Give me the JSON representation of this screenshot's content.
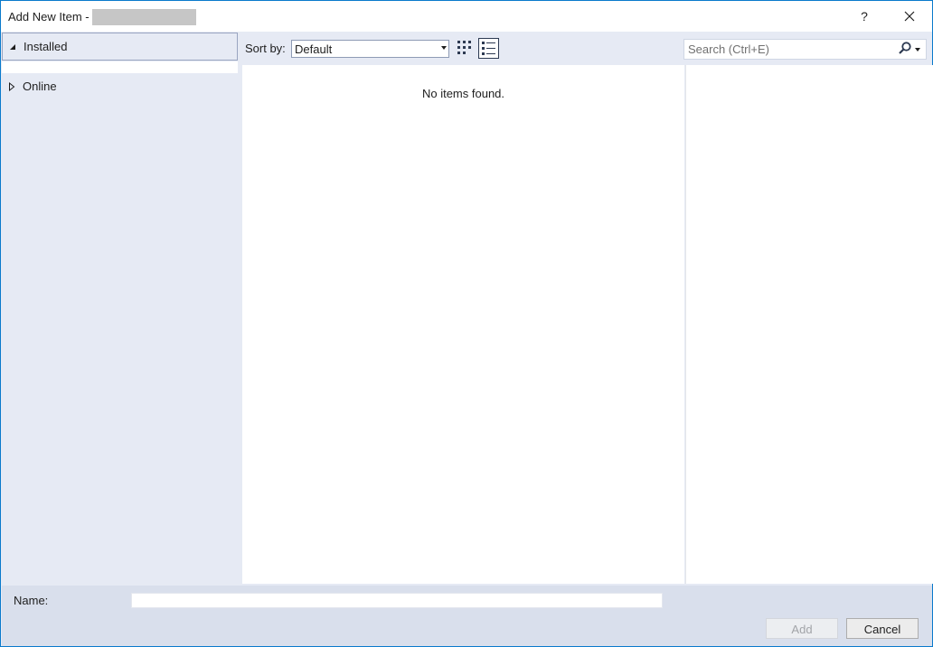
{
  "window": {
    "title": "Add New Item -",
    "help_label": "?",
    "close_label": "✕"
  },
  "tree": {
    "items": [
      {
        "label": "Installed",
        "arrow": "◢",
        "expanded": true
      },
      {
        "label": "Online",
        "arrow": "▷",
        "expanded": false
      }
    ]
  },
  "toolbar": {
    "sort_label": "Sort by:",
    "sort_value": "Default",
    "search_placeholder": "Search (Ctrl+E)"
  },
  "main": {
    "empty_message": "No items found."
  },
  "footer": {
    "name_label": "Name:",
    "name_value": "",
    "add_label": "Add",
    "cancel_label": "Cancel"
  },
  "colors": {
    "accent_border": "#0a7acc",
    "panel_bg": "#e6eaf4",
    "footer_bg": "#d9dfec"
  },
  "icons": {
    "medium_view": "medium-icons-view-icon",
    "details_view": "list-details-view-icon",
    "search": "search-icon"
  }
}
